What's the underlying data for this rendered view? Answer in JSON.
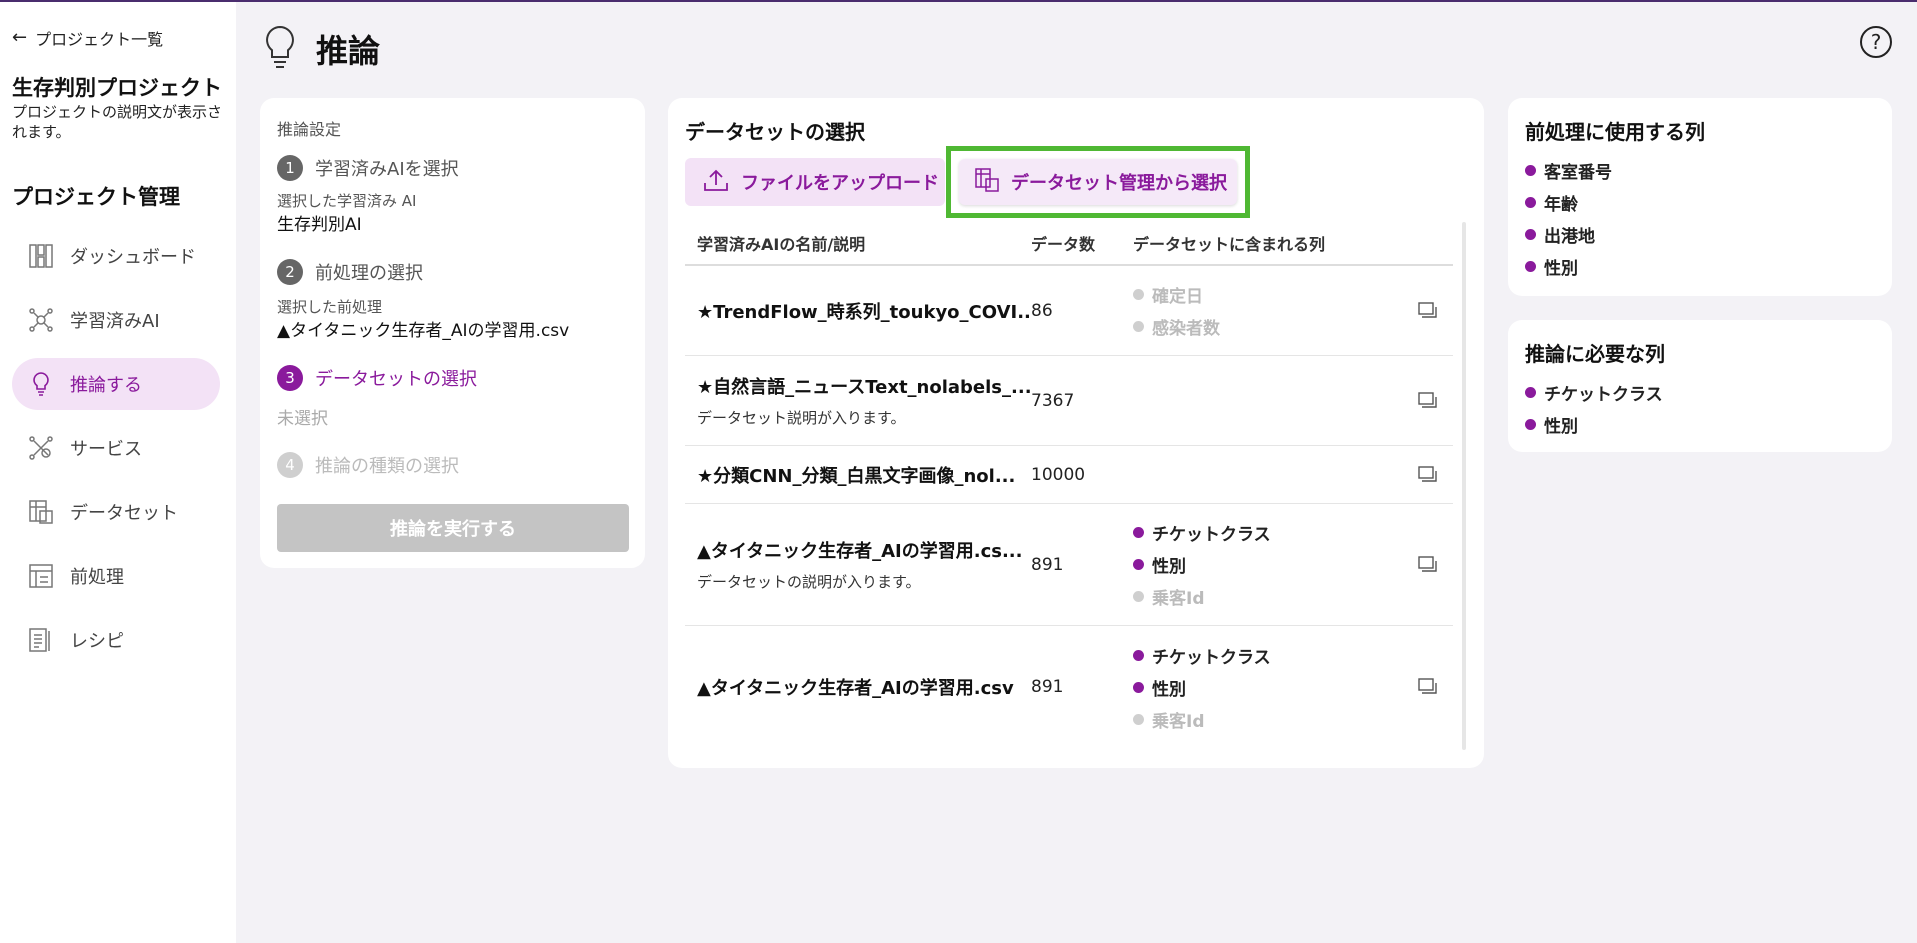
{
  "sidebar": {
    "back_label": "プロジェクト一覧",
    "project_title": "生存判別プロジェクト",
    "project_desc": "プロジェクトの説明文が表示されます。",
    "section_title": "プロジェクト管理",
    "items": [
      {
        "label": "ダッシュボード",
        "icon": "dashboard-icon"
      },
      {
        "label": "学習済みAI",
        "icon": "trained-ai-icon"
      },
      {
        "label": "推論する",
        "icon": "lightbulb-icon",
        "active": true
      },
      {
        "label": "サービス",
        "icon": "service-icon"
      },
      {
        "label": "データセット",
        "icon": "dataset-icon"
      },
      {
        "label": "前処理",
        "icon": "preprocess-icon"
      },
      {
        "label": "レシピ",
        "icon": "recipe-icon"
      }
    ]
  },
  "header": {
    "title": "推論",
    "help": "?"
  },
  "settings": {
    "heading": "推論設定",
    "step1": {
      "num": "1",
      "label": "学習済みAIを選択",
      "sub_label": "選択した学習済み AI",
      "sub_value": "生存判別AI"
    },
    "step2": {
      "num": "2",
      "label": "前処理の選択",
      "sub_label": "選択した前処理",
      "sub_value": "▲タイタニック生存者_AIの学習用.csv"
    },
    "step3": {
      "num": "3",
      "label": "データセットの選択",
      "sub_value": "未選択"
    },
    "step4": {
      "num": "4",
      "label": "推論の種類の選択"
    },
    "run_label": "推論を実行する"
  },
  "dataset": {
    "heading": "データセットの選択",
    "upload_label": "ファイルをアップロード",
    "select_label": "データセット管理から選択",
    "columns": {
      "name": "学習済みAIの名前/説明",
      "count": "データ数",
      "cols": "データセットに含まれる列"
    },
    "rows": [
      {
        "name": "★TrendFlow_時系列_toukyo_COVI...",
        "desc": "",
        "count": "86",
        "tags": [
          {
            "label": "確定日",
            "muted": true
          },
          {
            "label": "感染者数",
            "muted": true
          }
        ]
      },
      {
        "name": "★自然言語_ニュースText_nolabels_...",
        "desc": "データセット説明が入ります。",
        "count": "7367",
        "tags": []
      },
      {
        "name": "★分類CNN_分類_白黒文字画像_nol...",
        "desc": "",
        "count": "10000",
        "tags": []
      },
      {
        "name": "▲タイタニック生存者_AIの学習用.cs...",
        "desc": "データセットの説明が入ります。",
        "count": "891",
        "tags": [
          {
            "label": "チケットクラス",
            "muted": false
          },
          {
            "label": "性別",
            "muted": false
          },
          {
            "label": "乗客Id",
            "muted": true
          }
        ]
      },
      {
        "name": "▲タイタニック生存者_AIの学習用.csv",
        "desc": "",
        "count": "891",
        "tags": [
          {
            "label": "チケットクラス",
            "muted": false
          },
          {
            "label": "性別",
            "muted": false
          },
          {
            "label": "乗客Id",
            "muted": true
          }
        ]
      }
    ]
  },
  "preprocess_columns": {
    "heading": "前処理に使用する列",
    "items": [
      "客室番号",
      "年齢",
      "出港地",
      "性別"
    ]
  },
  "required_columns": {
    "heading": "推論に必要な列",
    "items": [
      "チケットクラス",
      "性別"
    ]
  },
  "colors": {
    "accent": "#8a1a9c",
    "highlight": "#4fb833"
  }
}
